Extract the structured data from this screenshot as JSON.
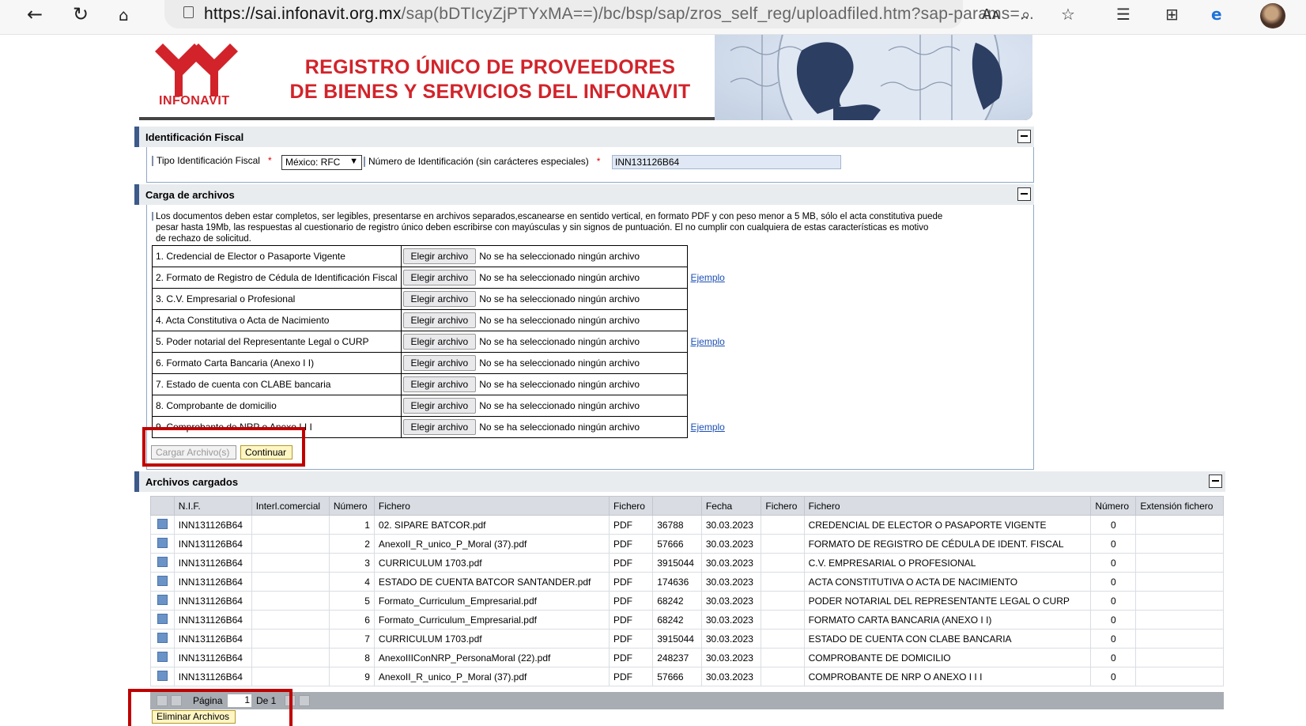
{
  "browser": {
    "url_host": "https://sai.infonavit.org.mx",
    "url_path": "/sap(bDTIcyZjPTYxMA==)/bc/bsp/sap/zros_self_reg/uploadfiled.htm?sap-params=...",
    "reader_label": "Aᴀ"
  },
  "header": {
    "logo_text": "INFONAVIT",
    "title_line1": "REGISTRO ÚNICO DE PROVEEDORES",
    "title_line2": "DE BIENES Y SERVICIOS  DEL INFONAVIT"
  },
  "fiscal": {
    "title": "Identificación Fiscal",
    "tipo_label": "Tipo Identificación Fiscal",
    "tipo_value": "México: RFC",
    "numero_label": "Número de Identificación (sin carácteres especiales)",
    "numero_value": "INN131126B64",
    "required_mark": "*"
  },
  "carga": {
    "title": "Carga de archivos",
    "notice_line1": "Los documentos deben estar completos, ser legibles, presentarse en archivos separados,escanearse en sentido vertical, en formato PDF y con peso menor a 5 MB, sólo el acta constitutiva puede",
    "notice_line2": "pesar hasta 19Mb, las respuestas al cuestionario de registro único deben escribirse con mayúsculas y sin signos de puntuación. El no cumplir con cualquiera de estas características es motivo",
    "notice_line3": "de rechazo de solicitud.",
    "choose_label": "Elegir archivo",
    "no_file_label": "No se ha seleccionado ningún archivo",
    "example_label": "Ejemplo",
    "rows": [
      {
        "label": "1. Credencial de Elector o Pasaporte Vigente",
        "example": ""
      },
      {
        "label": "2. Formato de Registro de Cédula de Identificación Fiscal",
        "example": "Ejemplo"
      },
      {
        "label": "3. C.V. Empresarial o Profesional",
        "example": ""
      },
      {
        "label": "4. Acta Constitutiva o Acta de Nacimiento",
        "example": ""
      },
      {
        "label": "5. Poder notarial del Representante Legal o CURP",
        "example": "Ejemplo"
      },
      {
        "label": "6. Formato Carta Bancaria (Anexo I I)",
        "example": ""
      },
      {
        "label": "7. Estado de cuenta con CLABE bancaria",
        "example": ""
      },
      {
        "label": "8. Comprobante de domicilio",
        "example": ""
      },
      {
        "label": "9. Comprobante de NRP o Anexo I I I",
        "example": "Ejemplo"
      }
    ],
    "upload_button": "Cargar Archivo(s)",
    "continue_button": "Continuar"
  },
  "archivos": {
    "title": "Archivos cargados",
    "columns": [
      "N.I.F.",
      "Interl.comercial",
      "Número",
      "Fichero",
      "Fichero",
      "",
      "Fecha",
      "Fichero",
      "Fichero",
      "Número",
      "Extensión fichero"
    ],
    "rows": [
      [
        "INN131126B64",
        "",
        "1",
        "02. SIPARE BATCOR.pdf",
        "PDF",
        "36788",
        "30.03.2023",
        "",
        "CREDENCIAL DE ELECTOR O PASAPORTE VIGENTE",
        "0",
        ""
      ],
      [
        "INN131126B64",
        "",
        "2",
        "AnexoII_R_unico_P_Moral (37).pdf",
        "PDF",
        "57666",
        "30.03.2023",
        "",
        "FORMATO DE REGISTRO DE CÉDULA DE IDENT. FISCAL",
        "0",
        ""
      ],
      [
        "INN131126B64",
        "",
        "3",
        "CURRICULUM 1703.pdf",
        "PDF",
        "3915044",
        "30.03.2023",
        "",
        "C.V. EMPRESARIAL O PROFESIONAL",
        "0",
        ""
      ],
      [
        "INN131126B64",
        "",
        "4",
        "ESTADO DE CUENTA BATCOR SANTANDER.pdf",
        "PDF",
        "174636",
        "30.03.2023",
        "",
        "ACTA CONSTITUTIVA O ACTA DE NACIMIENTO",
        "0",
        ""
      ],
      [
        "INN131126B64",
        "",
        "5",
        "Formato_Curriculum_Empresarial.pdf",
        "PDF",
        "68242",
        "30.03.2023",
        "",
        "PODER NOTARIAL DEL REPRESENTANTE LEGAL O CURP",
        "0",
        ""
      ],
      [
        "INN131126B64",
        "",
        "6",
        "Formato_Curriculum_Empresarial.pdf",
        "PDF",
        "68242",
        "30.03.2023",
        "",
        "FORMATO CARTA BANCARIA (ANEXO I I)",
        "0",
        ""
      ],
      [
        "INN131126B64",
        "",
        "7",
        "CURRICULUM 1703.pdf",
        "PDF",
        "3915044",
        "30.03.2023",
        "",
        "ESTADO DE CUENTA CON CLABE BANCARIA",
        "0",
        ""
      ],
      [
        "INN131126B64",
        "",
        "8",
        "AnexoIIIConNRP_PersonaMoral (22).pdf",
        "PDF",
        "248237",
        "30.03.2023",
        "",
        "COMPROBANTE DE DOMICILIO",
        "0",
        ""
      ],
      [
        "INN131126B64",
        "",
        "9",
        "AnexoII_R_unico_P_Moral (37).pdf",
        "PDF",
        "57666",
        "30.03.2023",
        "",
        "COMPROBANTE DE NRP O ANEXO I I I",
        "0",
        ""
      ]
    ],
    "pager_label": "Página",
    "pager_value": "1",
    "pager_of": "De 1",
    "delete_button": "Eliminar Archivos"
  }
}
